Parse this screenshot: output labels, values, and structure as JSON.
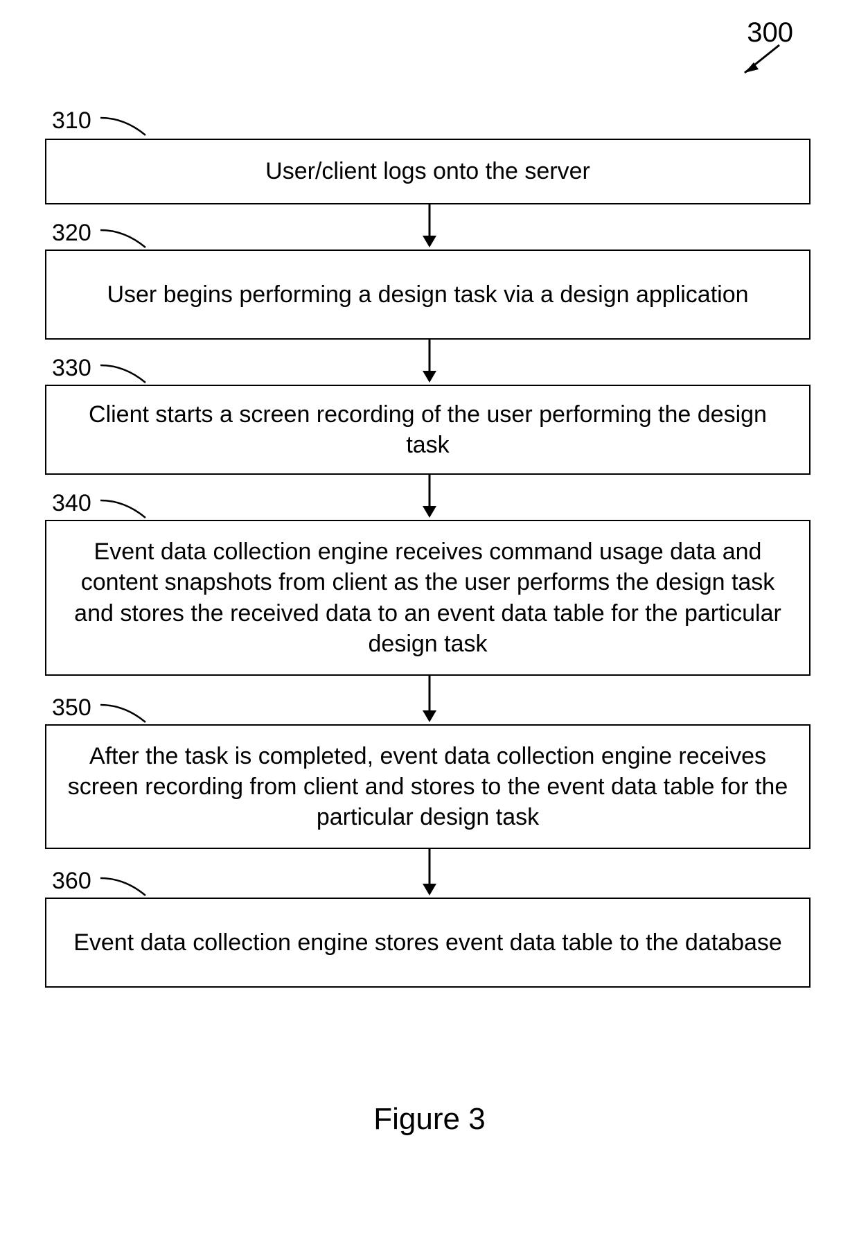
{
  "figure": {
    "number": "300",
    "caption": "Figure 3"
  },
  "steps": [
    {
      "label": "310",
      "text": "User/client logs onto the server"
    },
    {
      "label": "320",
      "text": "User begins performing a design task via a design application"
    },
    {
      "label": "330",
      "text": "Client starts a screen recording of the user performing the design task"
    },
    {
      "label": "340",
      "text": "Event data collection engine receives command usage data and content snapshots from client as the user performs the design task and stores the received data to an event data table for the particular design task"
    },
    {
      "label": "350",
      "text": "After the task is completed, event data collection engine receives screen recording from client and stores to the event data table for the particular design task"
    },
    {
      "label": "360",
      "text": "Event data collection engine stores event data table to the database"
    }
  ]
}
